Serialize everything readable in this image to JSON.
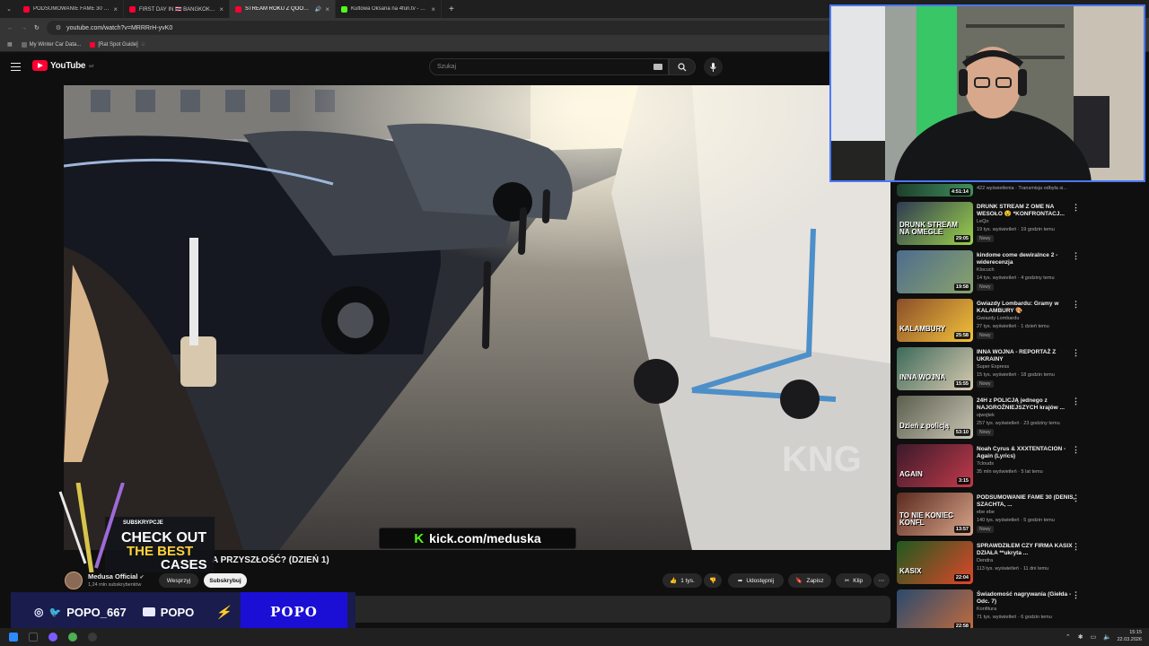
{
  "browser": {
    "tabs": [
      {
        "title": "PODSUMOWANIE FAME 30 (D...",
        "icon": "youtube-icon"
      },
      {
        "title": "FIRST DAY IN 🇹🇭 BANGKOK - Vo...",
        "icon": "youtube-icon"
      },
      {
        "title": "STREAM ROKU Z QOOSIK",
        "icon": "youtube-icon",
        "active": true
      },
      {
        "title": "Kultowa Oksana na 4fun.tv - dy...",
        "icon": "kick-icon"
      }
    ],
    "url": "youtube.com/watch?v=MRRRrH-yvK0",
    "bookmarks": [
      "My Winter Car Data...",
      "[Rat Spot Guide]"
    ]
  },
  "youtube": {
    "logo_text": "YouTube",
    "region": "MT",
    "search_placeholder": "Szukaj"
  },
  "video": {
    "title": "A PRZYSZŁOŚĆ? (DZIEŃ 1)",
    "kick_url": "kick.com/meduska",
    "kick_logo": "K",
    "watermark": "KNG"
  },
  "channel": {
    "name": "Medusa Official",
    "subscribers": "1,24 mln subskrybentów"
  },
  "actions": {
    "support": "Wesprzyj",
    "subscribe": "Subskrybuj",
    "likes": "1 tys.",
    "share": "Udostępnij",
    "save": "Zapisz",
    "clip": "Klip"
  },
  "recommendations": [
    {
      "duration": "4:51:14",
      "meta": "422 wyświetlenia · Transmisja odbyła si..."
    },
    {
      "title": "DRUNK STREAM Z OME NA WESOŁO 😵 *KONFRONTACJ...",
      "channel": "LeQo",
      "meta": "19 tys. wyświetleń · 19 godzin temu",
      "badge": "Nowy",
      "duration": "29:05",
      "thumb_text": "DRUNK STREAM NA OMEGLE",
      "colors": [
        "#2e3a52",
        "#9bd14a"
      ]
    },
    {
      "title": "kindome come dewiralnce 2 - widerecenzja",
      "channel": "Klocuch",
      "meta": "14 tys. wyświetleń · 4 godziny temu",
      "badge": "Nowy",
      "duration": "19:58",
      "thumb_text": "",
      "colors": [
        "#4d6c8f",
        "#8aa36a"
      ]
    },
    {
      "title": "Gwiazdy Lombardu: Gramy w KALAMBURY 🎨",
      "channel": "Gwiazdy Lombardu",
      "meta": "27 tys. wyświetleń · 1 dzień temu",
      "badge": "Nowy",
      "duration": "25:58",
      "thumb_text": "KALAMBURY",
      "colors": [
        "#8a4e2a",
        "#f2c23a"
      ]
    },
    {
      "title": "INNA WOJNA - REPORTAŻ Z UKRAINY",
      "channel": "Super Express",
      "meta": "15 tys. wyświetleń · 18 godzin temu",
      "badge": "Nowy",
      "duration": "15:55",
      "thumb_text": "INNA WOJNA",
      "colors": [
        "#3d6a5a",
        "#d8c9b0"
      ]
    },
    {
      "title": "24H z POLICJĄ jednego z NAJGROŹNIEJSZYCH krajów ...",
      "channel": "ojwojtek",
      "meta": "257 tys. wyświetleń · 23 godziny temu",
      "badge": "Nowy",
      "duration": "53:10",
      "thumb_text": "Dzień z policją",
      "colors": [
        "#5b5f4e",
        "#c9c4b4"
      ]
    },
    {
      "title": "Noah Cyrus & XXXTENTACION - Again (Lyrics)",
      "channel": "7clouds",
      "meta": "35 mln wyświetleń · 5 lat temu",
      "badge": "",
      "duration": "3:15",
      "thumb_text": "AGAIN",
      "colors": [
        "#3a1a2a",
        "#c13a4a"
      ]
    },
    {
      "title": "PODSUMOWANIE FAME 30 (DENIS, SZACHTA, ...",
      "channel": "ebe ebe",
      "meta": "140 tys. wyświetleń · 5 godzin temu",
      "badge": "Nowy",
      "duration": "13:57",
      "thumb_text": "TO NIE KONIEC KONFL",
      "colors": [
        "#5a2a1f",
        "#d9a58a"
      ]
    },
    {
      "title": "SPRAWDZIŁEM CZY FIRMA KASIX DZIAŁA **ukryta ...",
      "channel": "Dendra",
      "meta": "113 tys. wyświetleń · 11 dni temu",
      "badge": "",
      "duration": "22:04",
      "thumb_text": "KASIX",
      "colors": [
        "#1e5a1e",
        "#e0462a"
      ]
    },
    {
      "title": "Świadomość nagrywania (Giełda - Odc. 7)",
      "channel": "Konfitura",
      "meta": "71 tys. wyświetleń · 6 godzin temu",
      "badge": "",
      "duration": "22:58",
      "thumb_text": "",
      "colors": [
        "#2a4a6e",
        "#c46b3d"
      ]
    }
  ],
  "case_ad": {
    "label": "SUBSKRYPCJE",
    "line1": "CHECK OUT",
    "line2": "THE BEST",
    "line3": "CASES"
  },
  "stream_bar": {
    "handle": "POPO_667",
    "youtube": "POPO",
    "logo": "POPO"
  },
  "taskbar": {
    "time": "15:15",
    "date": "22.03.2026"
  }
}
